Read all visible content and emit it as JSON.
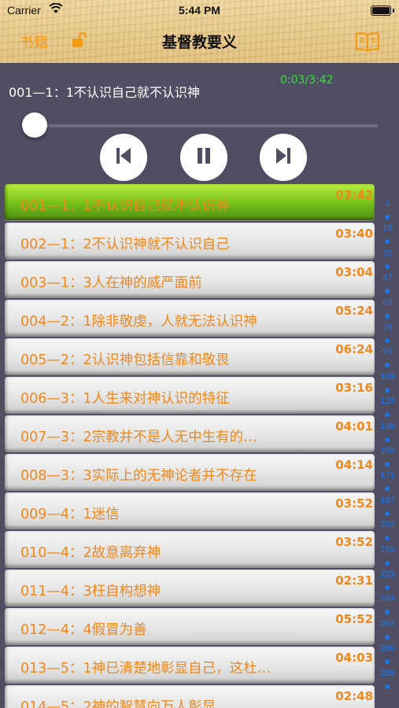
{
  "status": {
    "carrier": "Carrier",
    "time": "5:44 PM"
  },
  "nav": {
    "books_label": "书籍",
    "title": "基督教要义"
  },
  "player": {
    "track_title": "001—1：1不认识自己就不认识神",
    "timer": "0:03/3:42",
    "progress": 0.014
  },
  "tracks": [
    {
      "name": "001—1：1不认识自己就不认识神",
      "duration": "03:42",
      "active": true
    },
    {
      "name": "002—1：2不认识神就不认识自己",
      "duration": "03:40"
    },
    {
      "name": "003—1：3人在神的威严面前",
      "duration": "03:04"
    },
    {
      "name": "004—2：1除非敬虔，人就无法认识神",
      "duration": "05:24"
    },
    {
      "name": "005—2：2认识神包括信靠和敬畏",
      "duration": "06:24"
    },
    {
      "name": "006—3：1人生来对神认识的特征",
      "duration": "03:16"
    },
    {
      "name": "007—3：2宗教并不是人无中生有的…",
      "duration": "04:01"
    },
    {
      "name": "008—3：3实际上的无神论者并不存在",
      "duration": "04:14"
    },
    {
      "name": "009—4：1迷信",
      "duration": "03:52"
    },
    {
      "name": "010—4：2故意离弃神",
      "duration": "03:52"
    },
    {
      "name": "011—4：3枉自构想神",
      "duration": "02:31"
    },
    {
      "name": "012—4：4假冒为善",
      "duration": "05:52"
    },
    {
      "name": "013—5：1神已清楚地彰显自己，这杜…",
      "duration": "04:03"
    },
    {
      "name": "014—5：2神的智慧向万人彰显",
      "duration": "02:48"
    }
  ],
  "index": [
    "1",
    "16",
    "32",
    "47",
    "63",
    "78",
    "94",
    "109",
    "125",
    "140",
    "156",
    "171",
    "187",
    "202",
    "218",
    "233",
    "249",
    "264",
    "280",
    "295"
  ],
  "colors": {
    "accent_orange": "#f0881c",
    "timer_green": "#35e335",
    "index_blue": "#1f74e6",
    "panel": "#4f4e63"
  }
}
